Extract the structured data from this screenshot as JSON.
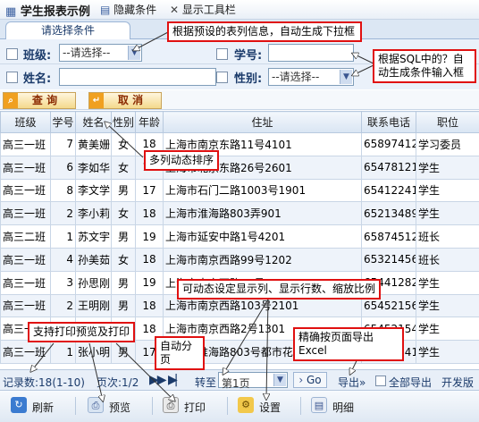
{
  "app": {
    "title": "学生报表示例",
    "hide_conditions": "隐藏条件",
    "show_toolbar": "显示工具栏"
  },
  "tab": {
    "label": "请选择条件"
  },
  "form": {
    "class_label": "班级:",
    "class_value": "--请选择--",
    "name_label": "姓名:",
    "name_value": "",
    "sid_label": "学号:",
    "sid_value": "",
    "gender_label": "性别:",
    "gender_value": "--请选择--"
  },
  "buttons": {
    "query": "查  询",
    "cancel": "取  消"
  },
  "grid": {
    "headers": [
      "班级",
      "学号",
      "姓名",
      "性别",
      "年龄",
      "住址",
      "联系电话",
      "职位"
    ],
    "rows": [
      [
        "高三一班",
        "7",
        "黄美姗",
        "女",
        "18",
        "上海市南京东路11号4101",
        "65897412",
        "学习委员"
      ],
      [
        "高三一班",
        "6",
        "李如华",
        "女",
        "18",
        "上海市北京东路26号2601",
        "65478121",
        "学生"
      ],
      [
        "高三一班",
        "8",
        "李文学",
        "男",
        "17",
        "上海市石门二路1003号1901",
        "65412241",
        "学生"
      ],
      [
        "高三一班",
        "2",
        "李小莉",
        "女",
        "18",
        "上海市淮海路803弄901",
        "65213489",
        "学生"
      ],
      [
        "高三二班",
        "1",
        "苏文宇",
        "男",
        "19",
        "上海市延安中路1号4201",
        "65874512",
        "班长"
      ],
      [
        "高三一班",
        "4",
        "孙美茹",
        "女",
        "18",
        "上海市南京西路99号1202",
        "65321456",
        "班长"
      ],
      [
        "高三一班",
        "3",
        "孙思刚",
        "男",
        "19",
        "上海市南京西路25号302",
        "65441282",
        "学生"
      ],
      [
        "高三一班",
        "2",
        "王明刚",
        "男",
        "18",
        "上海市南京西路103号2101",
        "65452156",
        "学生"
      ],
      [
        "高三一班",
        "5",
        "王卫明",
        "男",
        "18",
        "上海市南京西路2号1301",
        "65452154",
        "学生"
      ],
      [
        "高三一班",
        "1",
        "张小明",
        "男",
        "17",
        "上海市淮海路803号都市花园20号楼501",
        "63545241",
        "学生"
      ]
    ]
  },
  "pager": {
    "records": "记录数:18(1-10)",
    "page": "页次:1/2",
    "goto_label": "转至",
    "goto_value": "第1页",
    "go_button": "Go",
    "export": "导出»",
    "export_all": "全部导出",
    "developer": "开发版"
  },
  "toolbar": {
    "refresh": "刷新",
    "preview": "预览",
    "print": "打印",
    "settings": "设置",
    "details": "明细"
  },
  "annotations": {
    "dropdown": "根据预设的表列信息，自动生成下拉框",
    "sql": "根据SQL中的？自动生成条件输入框",
    "sort": "多列动态排序",
    "dynamic": "可动态设定显示列、显示行数、缩放比例",
    "print": "支持打印预览及打印",
    "paging": "自动分页",
    "excel": "精确按页面导出Excel"
  },
  "colors": {
    "header_bg": "#d9e5f3",
    "accent": "#1a3a6a",
    "annotation_border": "#e01010",
    "button_bg": "#f4d98c"
  },
  "icons": {
    "title_icon": "report-icon",
    "hide_icon": "layout-icon",
    "toolbar_icon": "tools-icon",
    "query_icon": "search-icon",
    "cancel_icon": "undo-icon",
    "refresh_icon": "refresh-icon",
    "preview_icon": "preview-icon",
    "print_icon": "printer-icon",
    "settings_icon": "settings-icon",
    "details_icon": "details-icon"
  }
}
